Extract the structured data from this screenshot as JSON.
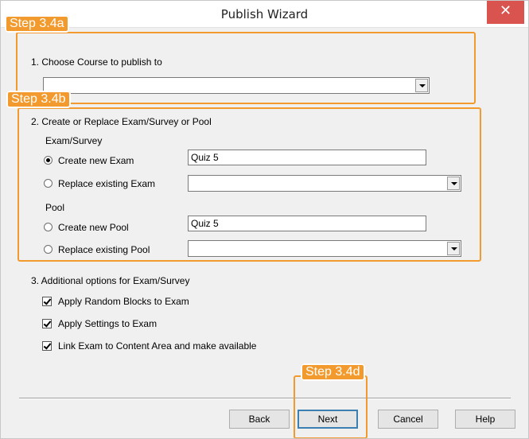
{
  "window": {
    "title": "Publish Wizard",
    "close_glyph": "✕"
  },
  "annotations": {
    "step_a": "Step 3.4a",
    "step_b": "Step 3.4b",
    "step_d": "Step 3.4d",
    "color": "#f29a2e"
  },
  "section1": {
    "heading": "1. Choose Course to publish to",
    "course_value": ""
  },
  "section2": {
    "heading": "2. Create or Replace Exam/Survey or Pool",
    "exam_group_label": "Exam/Survey",
    "create_exam_label": "Create new Exam",
    "create_exam_value": "Quiz 5",
    "replace_exam_label": "Replace existing Exam",
    "replace_exam_value": "",
    "pool_group_label": "Pool",
    "create_pool_label": "Create new Pool",
    "create_pool_value": "Quiz 5",
    "replace_pool_label": "Replace existing Pool",
    "replace_pool_value": "",
    "selected_option": "Create new Exam"
  },
  "section3": {
    "heading": "3. Additional options for Exam/Survey",
    "options": [
      {
        "label": "Apply Random Blocks to Exam",
        "checked": true
      },
      {
        "label": "Apply Settings to Exam",
        "checked": true
      },
      {
        "label": "Link Exam to Content Area and make available",
        "checked": true
      }
    ]
  },
  "buttons": {
    "back": "Back",
    "next": "Next",
    "cancel": "Cancel",
    "help": "Help"
  }
}
